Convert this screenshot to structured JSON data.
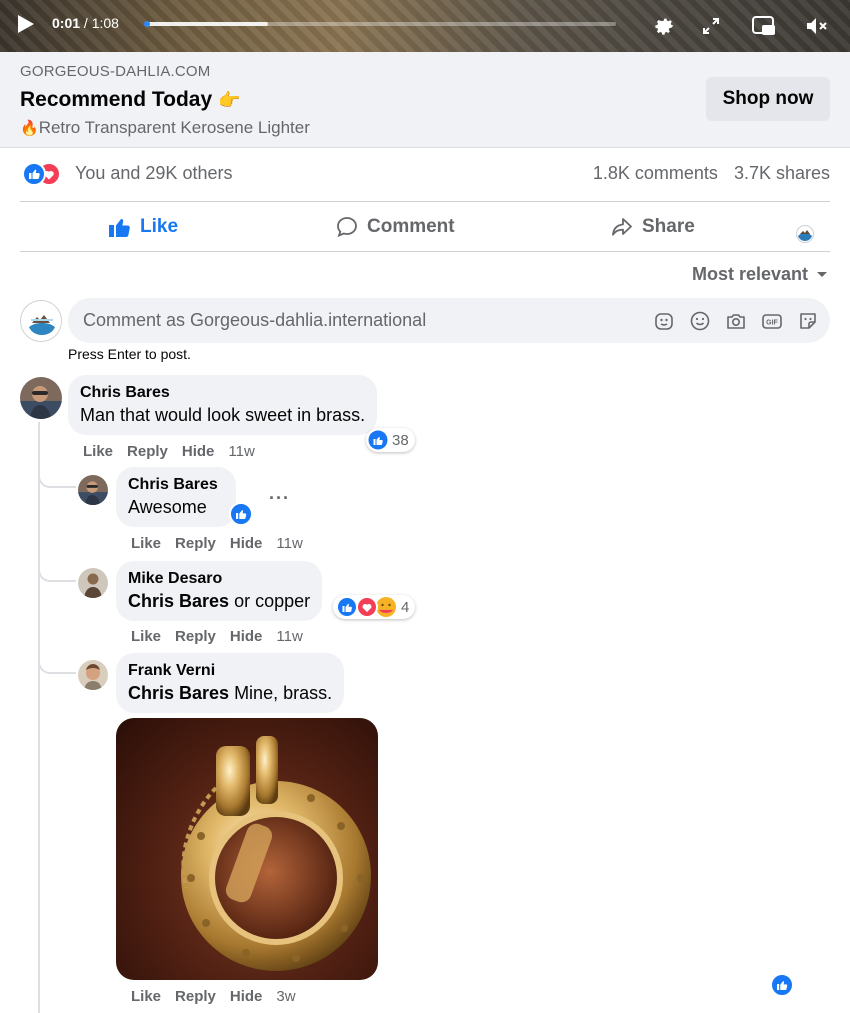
{
  "video": {
    "current_time": "0:01",
    "duration": "/ 1:08",
    "progress_percent": 26
  },
  "ad": {
    "domain": "GORGEOUS-DAHLIA.COM",
    "title": "Recommend Today",
    "title_emoji": "👉",
    "subtitle": "Retro Transparent Kerosene Lighter",
    "subtitle_emoji": "🔥",
    "cta": "Shop now"
  },
  "stats": {
    "reactions_text": "You and 29K others",
    "comments": "1.8K comments",
    "shares": "3.7K shares"
  },
  "actions": {
    "like": "Like",
    "comment": "Comment",
    "share": "Share"
  },
  "sort": {
    "label": "Most relevant"
  },
  "composer": {
    "placeholder": "Comment as Gorgeous-dahlia.international",
    "hint": "Press Enter to post.",
    "gif_label": "GIF"
  },
  "comments": [
    {
      "author": "Chris Bares",
      "text": "Man that would look sweet in brass.",
      "reactions": "38",
      "actions": [
        "Like",
        "Reply",
        "Hide"
      ],
      "time": "11w"
    },
    {
      "author": "Chris Bares",
      "text": "Awesome",
      "actions": [
        "Like",
        "Reply",
        "Hide"
      ],
      "time": "11w",
      "more": "···"
    },
    {
      "author": "Mike Desaro",
      "mention": "Chris Bares",
      "text": " or copper",
      "reactions": "4",
      "actions": [
        "Like",
        "Reply",
        "Hide"
      ],
      "time": "11w"
    },
    {
      "author": "Frank Verni",
      "mention": "Chris Bares",
      "text": " Mine, brass.",
      "actions": [
        "Like",
        "Reply",
        "Hide"
      ],
      "time": "3w"
    }
  ],
  "colors": {
    "brand_blue": "#1877f2",
    "love_red": "#f33e58",
    "secondary_text": "#65676b",
    "bubble_bg": "#f0f2f5"
  }
}
